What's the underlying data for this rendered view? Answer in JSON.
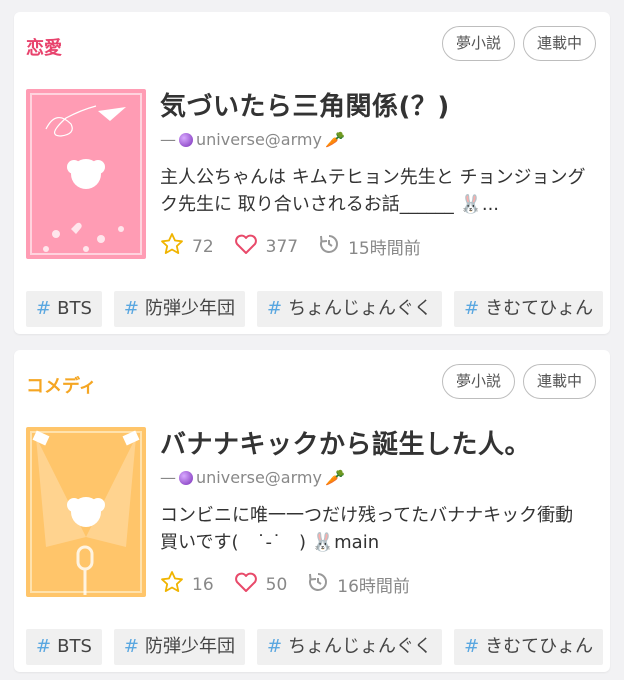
{
  "stories": [
    {
      "genre": "恋愛",
      "genre_color": "#e8436d",
      "badges": [
        "夢小説",
        "連載中"
      ],
      "title": "気づいたら三角関係(？)",
      "author_prefix": "—",
      "author": "universe@army",
      "author_icons": [
        "purple-crystal-ball-icon",
        "carrot-icon"
      ],
      "description": "主人公ちゃんは キムテヒョン先生と チョンジョングク先生に 取り合いされるお話______ 🐰...",
      "stars": "72",
      "likes": "377",
      "updated": "15時間前",
      "cover_color": "#ff9cb4",
      "tags": [
        "BTS",
        "防弾少年団",
        "ちょんじょんぐく",
        "きむてひょん"
      ]
    },
    {
      "genre": "コメディ",
      "genre_color": "#f5a623",
      "badges": [
        "夢小説",
        "連載中"
      ],
      "title": "バナナキックから誕生した人。",
      "author_prefix": "—",
      "author": "universe@army",
      "author_icons": [
        "purple-crystal-ball-icon",
        "carrot-icon"
      ],
      "description": "コンビニに唯一一つだけ残ってたバナナキック衝動買いです(　˙-˙　) 🐰main",
      "stars": "16",
      "likes": "50",
      "updated": "16時間前",
      "cover_color": "#ffc56a",
      "tags": [
        "BTS",
        "防弾少年団",
        "ちょんじょんぐく",
        "きむてひょん"
      ]
    }
  ],
  "hash": "#"
}
